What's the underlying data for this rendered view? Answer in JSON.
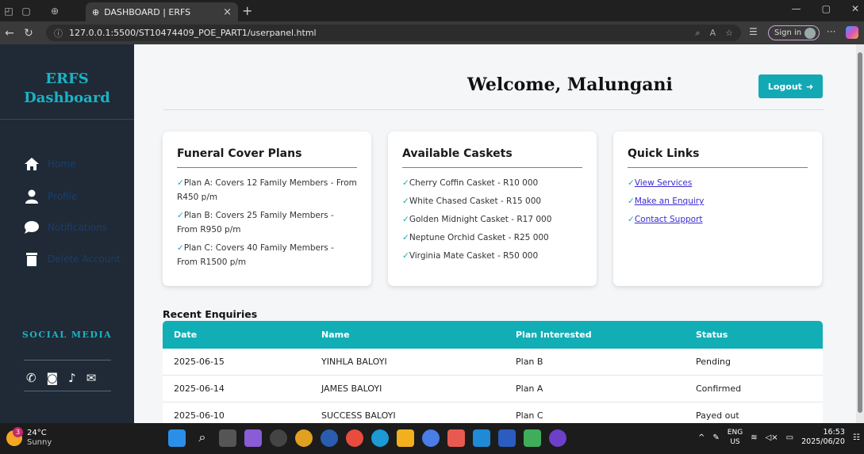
{
  "browser": {
    "tab_title": "DASHBOARD | ERFS",
    "url": "127.0.0.1:5500/ST10474409_POE_PART1/userpanel.html",
    "sign_in": "Sign in"
  },
  "sidebar": {
    "brand_line1": "ERFS",
    "brand_line2": "Dashboard",
    "items": [
      {
        "label": "Home",
        "icon": "home-icon"
      },
      {
        "label": "Profile",
        "icon": "user-icon"
      },
      {
        "label": "Notifications",
        "icon": "chat-bubble-icon"
      },
      {
        "label": "Delete Account",
        "icon": "trash-icon"
      }
    ],
    "social_title": "SOCIAL MEDIA",
    "social_icons": [
      "whatsapp-icon",
      "instagram-icon",
      "tiktok-icon",
      "envelope-icon"
    ]
  },
  "header": {
    "welcome": "Welcome, Malungani",
    "logout_label": "Logout"
  },
  "cards": [
    {
      "title": "Funeral Cover Plans",
      "items": [
        "Plan A: Covers 12 Family Members - From R450 p/m",
        "Plan B: Covers 25 Family Members - From R950 p/m",
        "Plan C: Covers 40 Family Members - From R1500 p/m"
      ]
    },
    {
      "title": "Available Caskets",
      "items": [
        "Cherry Coffin Casket - R10 000",
        "White Chased Casket - R15 000",
        "Golden Midnight Casket - R17 000",
        "Neptune Orchid Casket - R25 000",
        "Virginia Mate Casket - R50 000"
      ]
    },
    {
      "title": "Quick Links",
      "links": [
        "View Services",
        "Make an Enquiry",
        "Contact Support"
      ]
    }
  ],
  "enquiries": {
    "title": "Recent Enquiries",
    "headers": [
      "Date",
      "Name",
      "Plan Interested",
      "Status"
    ],
    "rows": [
      [
        "2025-06-15",
        "YINHLA BALOYI",
        "Plan B",
        "Pending"
      ],
      [
        "2025-06-14",
        "JAMES BALOYI",
        "Plan A",
        "Confirmed"
      ],
      [
        "2025-06-10",
        "SUCCESS BALOYI",
        "Plan C",
        "Payed out"
      ]
    ]
  },
  "taskbar": {
    "weather_temp": "24°C",
    "weather_cond": "Sunny",
    "weather_badge": "3",
    "lang_line1": "ENG",
    "lang_line2": "US",
    "time": "16:53",
    "date": "2025/06/20"
  },
  "colors": {
    "accent": "#12a9b5",
    "sidebar_bg": "#1f2a36",
    "brand_text": "#1ab3c4",
    "link": "#3a2ad0"
  }
}
